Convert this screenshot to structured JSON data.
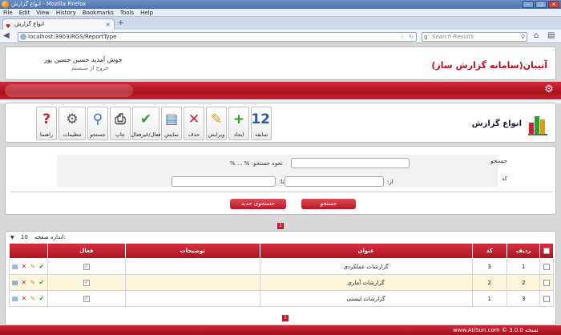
{
  "browser": {
    "window_title": "انواع گزارش - Mozilla Firefox",
    "menu": [
      "File",
      "Edit",
      "View",
      "History",
      "Bookmarks",
      "Tools",
      "Help"
    ],
    "tab_title": "انواع گزارش",
    "url": "localhost:3903/RGS/ReportType",
    "search_placeholder": "Search Results"
  },
  "header": {
    "app_title": "آتیبان(سامانه گزارش ساز)",
    "welcome": "خوش آمدید حسین حسین پور",
    "logout": "خروج از سیستم"
  },
  "toolbar": {
    "page_title": "انواع گزارش",
    "buttons": [
      {
        "label": "سابقه",
        "icon": "calendar-icon",
        "glyph": "12",
        "color": "#2a5aa8"
      },
      {
        "label": "ایجاد",
        "icon": "plus-icon",
        "glyph": "+",
        "color": "#2e9e2e"
      },
      {
        "label": "ویرایش",
        "icon": "pencil-icon",
        "glyph": "✎",
        "color": "#d99a1c"
      },
      {
        "label": "حذف",
        "icon": "delete-x-icon",
        "glyph": "✕",
        "color": "#c8232f"
      },
      {
        "label": "نمایش",
        "icon": "document-icon",
        "glyph": "▤",
        "color": "#3a6fb5"
      },
      {
        "label": "فعال/غیرفعال",
        "icon": "checkmark-icon",
        "glyph": "✔",
        "color": "#2e9e2e"
      },
      {
        "label": "چاپ",
        "icon": "printer-icon",
        "glyph": "⎙",
        "color": "#555555"
      },
      {
        "label": "جستجو",
        "icon": "magnifier-icon",
        "glyph": "⚲",
        "color": "#3a6fb5"
      },
      {
        "label": "تنظیمات",
        "icon": "settings-gear-icon",
        "glyph": "⚙",
        "color": "#555555"
      },
      {
        "label": "راهنما",
        "icon": "help-icon",
        "glyph": "?",
        "color": "#c8232f"
      }
    ]
  },
  "search": {
    "label_search": "جستجو",
    "label_code": "کد",
    "how_label": "نحوه جستجو: % ... %",
    "from_label": "از:",
    "to_label": "تا:",
    "search_value": "",
    "from_value": "",
    "to_value": "",
    "btn_search": "جستجو",
    "btn_new": "جستجوی جدید"
  },
  "grid": {
    "page_size_label": "اندازه صفحه:",
    "page_size_value": "10",
    "page_number": "1",
    "columns": {
      "row": "ردیف",
      "code": "کد",
      "title": "عنوان",
      "description": "توضیحات",
      "active": "فعال"
    },
    "rows": [
      {
        "row": "1",
        "code": "3",
        "title": "گزارشات عملکردی",
        "description": "",
        "active": true
      },
      {
        "row": "2",
        "code": "2",
        "title": "گزارشات آماری",
        "description": "",
        "active": true
      },
      {
        "row": "3",
        "code": "1",
        "title": "گزارشات لیستی",
        "description": "",
        "active": true
      }
    ]
  },
  "footer": {
    "text": "www.AtiSun.com © نسخه 3.0.0"
  },
  "colors": {
    "brand_red": "#b3121f",
    "row_alt": "#fbf6dc"
  }
}
